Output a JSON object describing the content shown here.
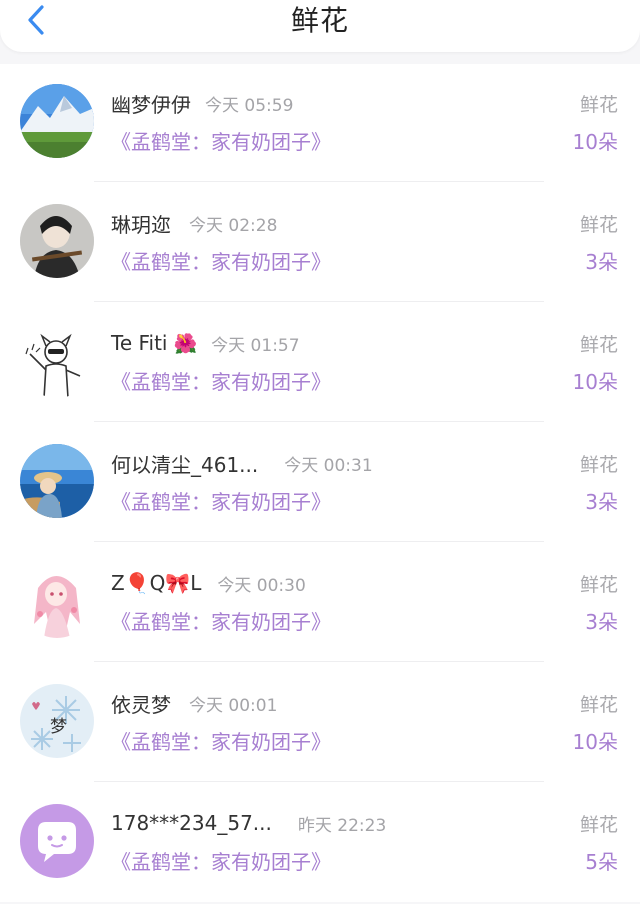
{
  "header": {
    "title": "鲜花"
  },
  "colors": {
    "accent_purple": "#a77fd1",
    "back_blue": "#3a8bf0",
    "muted_gray": "#a4a4a8"
  },
  "items": [
    {
      "name": "幽梦伊伊",
      "time": "今天 05:59",
      "subtitle": "《孟鹤堂：家有奶团子》",
      "type": "鲜花",
      "count": "10朵"
    },
    {
      "name": "琳玥迩",
      "time": "今天 02:28",
      "subtitle": "《孟鹤堂：家有奶团子》",
      "type": "鲜花",
      "count": "3朵"
    },
    {
      "name": "Te Fiti",
      "emoji": "🌺",
      "time": "今天 01:57",
      "subtitle": "《孟鹤堂：家有奶团子》",
      "type": "鲜花",
      "count": "10朵"
    },
    {
      "name": "何以清尘_461...",
      "time": "今天 00:31",
      "subtitle": "《孟鹤堂：家有奶团子》",
      "type": "鲜花",
      "count": "3朵"
    },
    {
      "name": "Z🎈Q🎀L",
      "time": "今天 00:30",
      "subtitle": "《孟鹤堂：家有奶团子》",
      "type": "鲜花",
      "count": "3朵"
    },
    {
      "name": "依灵梦",
      "time": "今天 00:01",
      "subtitle": "《孟鹤堂：家有奶团子》",
      "type": "鲜花",
      "count": "10朵"
    },
    {
      "name": "178***234_57...",
      "time": "昨天 22:23",
      "subtitle": "《孟鹤堂：家有奶团子》",
      "type": "鲜花",
      "count": "5朵"
    }
  ]
}
